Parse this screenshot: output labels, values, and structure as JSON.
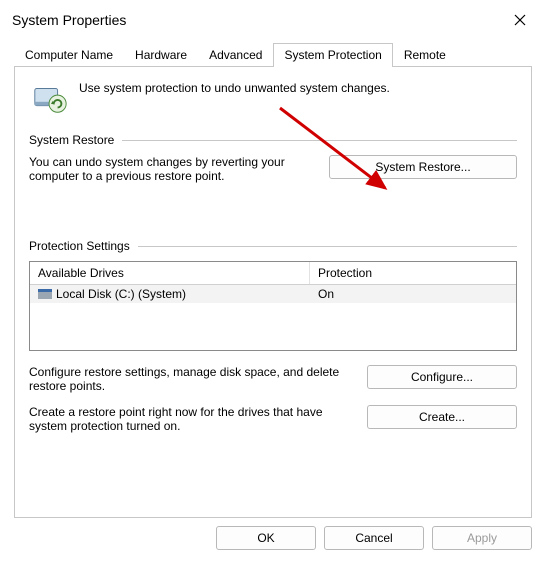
{
  "window": {
    "title": "System Properties"
  },
  "tabs": [
    {
      "label": "Computer Name"
    },
    {
      "label": "Hardware"
    },
    {
      "label": "Advanced"
    },
    {
      "label": "System Protection"
    },
    {
      "label": "Remote"
    }
  ],
  "intro": {
    "text": "Use system protection to undo unwanted system changes."
  },
  "restore_section": {
    "heading": "System Restore",
    "desc": "You can undo system changes by reverting your computer to a previous restore point.",
    "button": "System Restore..."
  },
  "protection_section": {
    "heading": "Protection Settings",
    "col_drives": "Available Drives",
    "col_protection": "Protection",
    "rows": [
      {
        "name": "Local Disk (C:) (System)",
        "protection": "On"
      }
    ],
    "configure_desc": "Configure restore settings, manage disk space, and delete restore points.",
    "configure_btn": "Configure...",
    "create_desc": "Create a restore point right now for the drives that have system protection turned on.",
    "create_btn": "Create..."
  },
  "buttons": {
    "ok": "OK",
    "cancel": "Cancel",
    "apply": "Apply"
  }
}
